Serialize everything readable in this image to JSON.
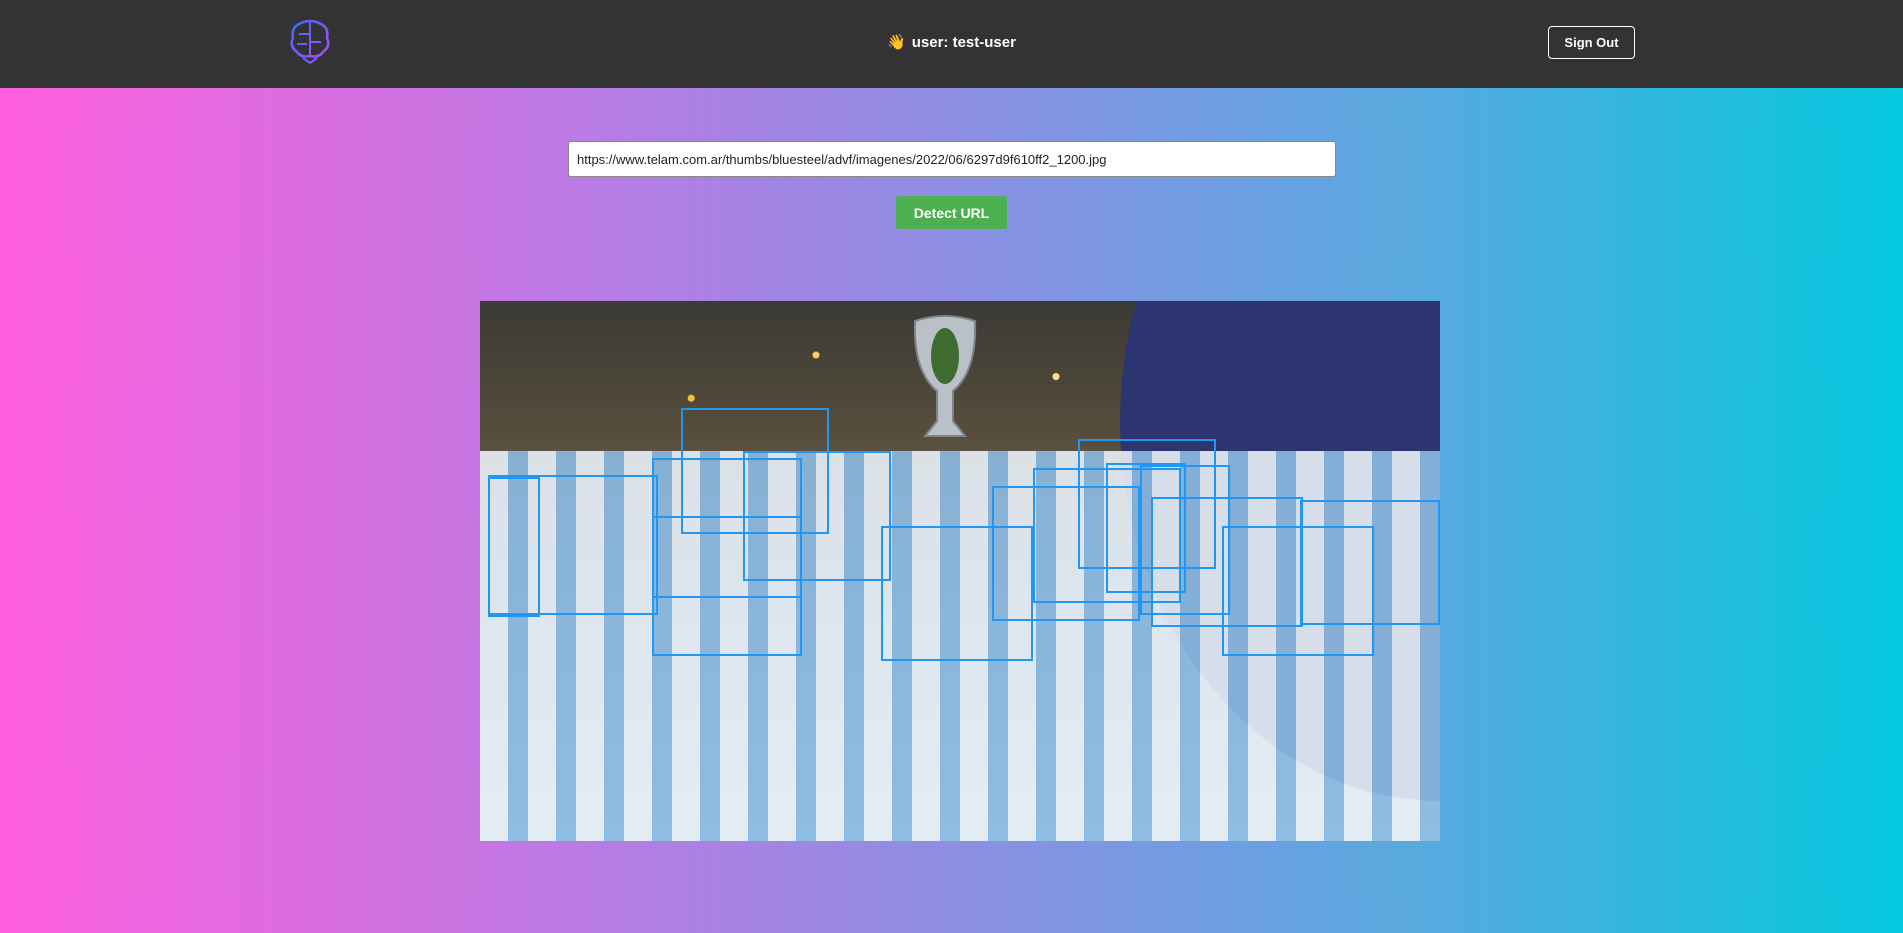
{
  "header": {
    "logo_icon": "brain-icon",
    "greeting_icon": "👋",
    "greeting": "user: test-user",
    "signout_label": "Sign Out"
  },
  "form": {
    "url_value": "https://www.telam.com.ar/thumbs/bluesteel/advf/imagenes/2022/06/6297d9f610ff2_1200.jpg",
    "detect_label": "Detect URL"
  },
  "colors": {
    "header_bg": "#333333",
    "button_green": "#4caf50",
    "box_blue": "#2196f3",
    "gradient_start": "#ff5edf",
    "gradient_end": "#04c8de"
  },
  "detections": {
    "count": 15
  }
}
